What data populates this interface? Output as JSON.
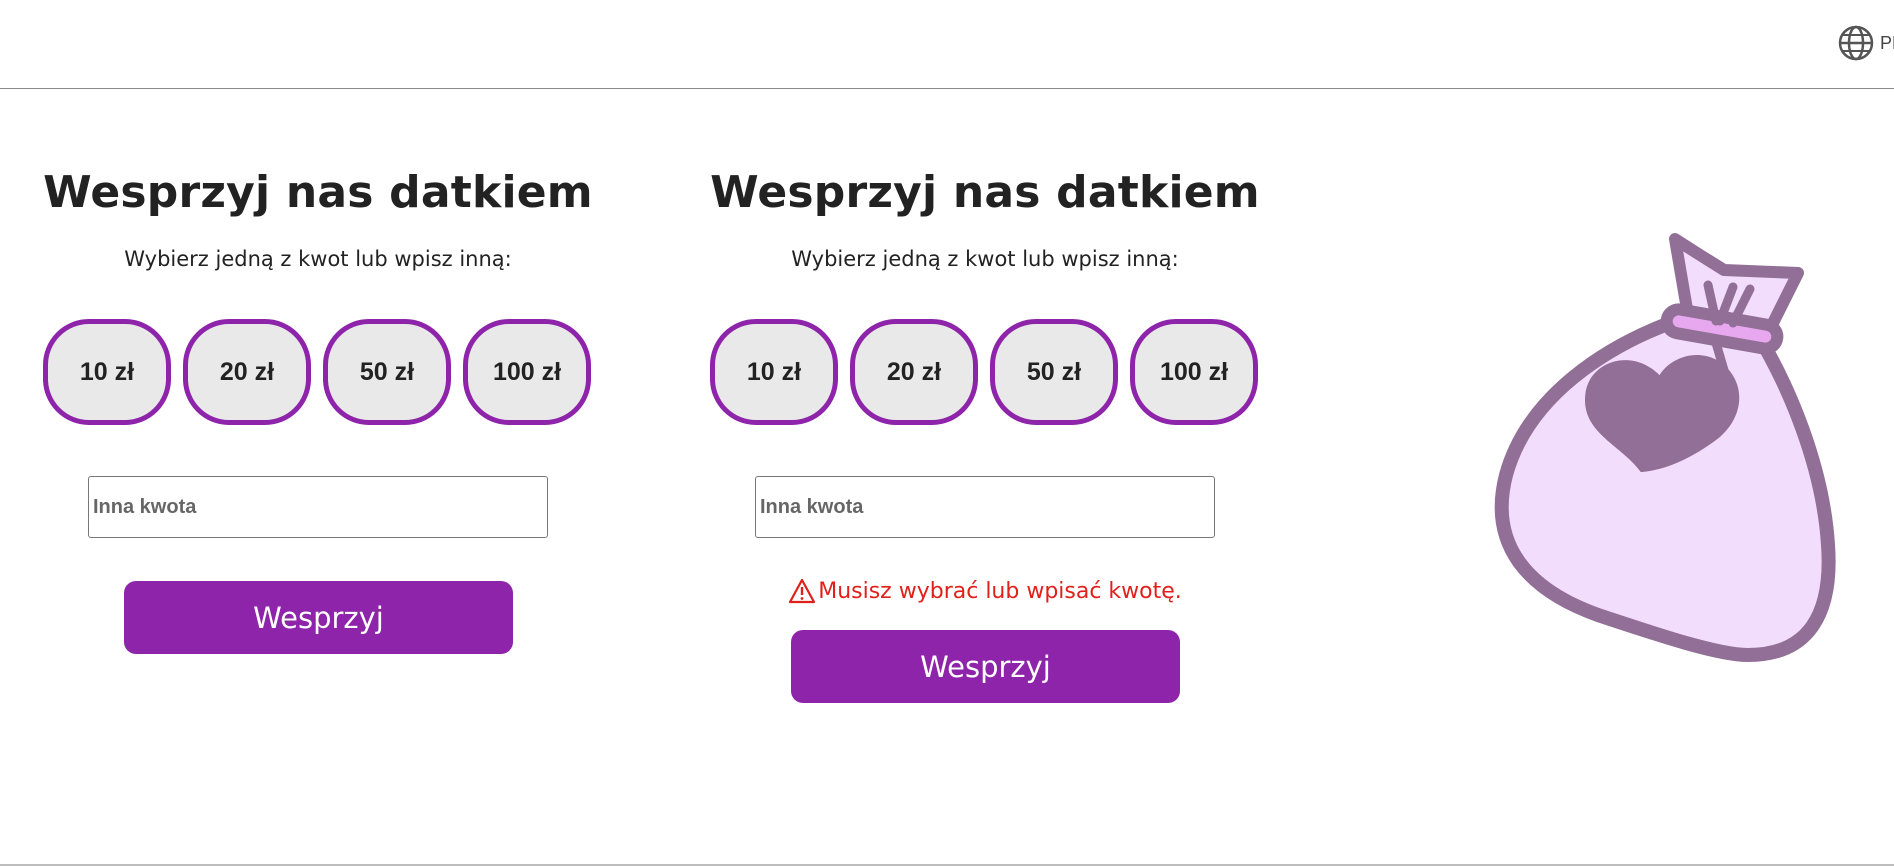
{
  "header": {
    "language_icon": "globe-icon",
    "language_label": "PL"
  },
  "forms": [
    {
      "title": "Wesprzyj nas datkiem",
      "subtitle": "Wybierz jedną z kwot lub wpisz inną:",
      "amounts": [
        "10 zł",
        "20 zł",
        "50 zł",
        "100 zł"
      ],
      "other_amount": {
        "placeholder": "Inna kwota",
        "value": ""
      },
      "submit_label": "Wesprzyj"
    },
    {
      "title": "Wesprzyj nas datkiem",
      "subtitle": "Wybierz jedną z kwot lub wpisz inną:",
      "amounts": [
        "10 zł",
        "20 zł",
        "50 zł",
        "100 zł"
      ],
      "other_amount": {
        "placeholder": "Inna kwota",
        "value": ""
      },
      "error": {
        "icon": "warning-icon",
        "text": "Musisz wybrać lub wpisać kwotę."
      },
      "submit_label": "Wesprzyj"
    }
  ],
  "illustration": {
    "icon": "money-bag-heart-icon"
  },
  "colors": {
    "accent": "#8e24aa",
    "amount_bg": "#e9e9e9",
    "error": "#e0201a",
    "bag_fill": "#f3ddfc",
    "bag_stroke": "#926f97"
  }
}
